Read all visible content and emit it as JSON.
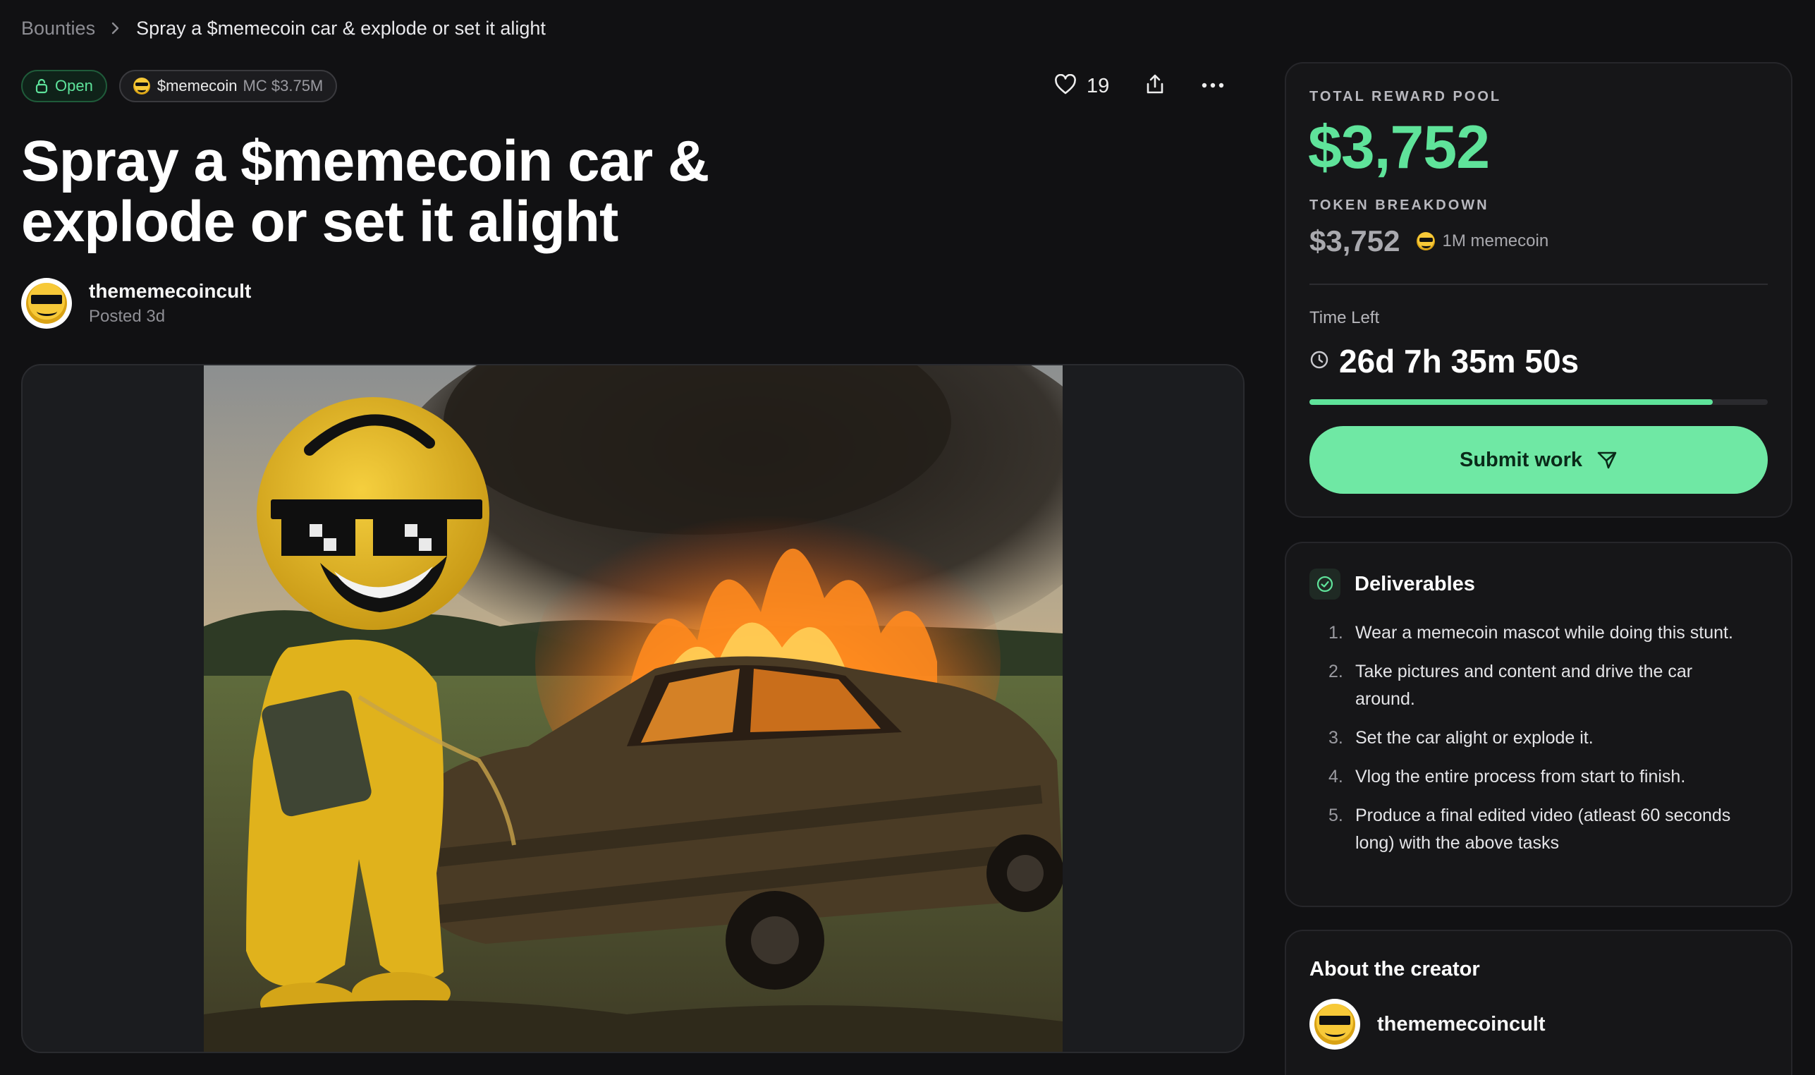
{
  "breadcrumb": {
    "parent": "Bounties",
    "current": "Spray a $memecoin car & explode or set it alight"
  },
  "status": {
    "label": "Open",
    "color": "#5ee39b"
  },
  "token_chip": {
    "name": "$memecoin",
    "market_cap": "MC $3.75M"
  },
  "actions": {
    "likes": "19",
    "icons": [
      "heart-icon",
      "share-icon",
      "more-icon"
    ]
  },
  "title": "Spray a $memecoin car & explode or set it alight",
  "author": {
    "name": "thememecoincult",
    "posted": "Posted 3d"
  },
  "reward": {
    "label": "TOTAL REWARD POOL",
    "amount": "$3,752",
    "breakdown_label": "TOKEN BREAKDOWN",
    "breakdown_usd": "$3,752",
    "breakdown_token": "1M memecoin",
    "time_label": "Time Left",
    "time_left": "26d 7h 35m 50s",
    "time_progress": 0.88,
    "submit_label": "Submit work",
    "accent": "#5fe39a"
  },
  "deliverables": {
    "title": "Deliverables",
    "items": [
      {
        "num": "1.",
        "text": "Wear a memecoin mascot while doing this stunt."
      },
      {
        "num": "2.",
        "text": "Take pictures and content and drive the car around."
      },
      {
        "num": "3.",
        "text": "Set the car alight or explode it."
      },
      {
        "num": "4.",
        "text": "Vlog the entire process from start to finish."
      },
      {
        "num": "5.",
        "text": "Produce a final edited video (atleast 60 seconds long) with the above tasks"
      }
    ]
  },
  "creator": {
    "title": "About the creator",
    "name": "thememecoincult"
  }
}
